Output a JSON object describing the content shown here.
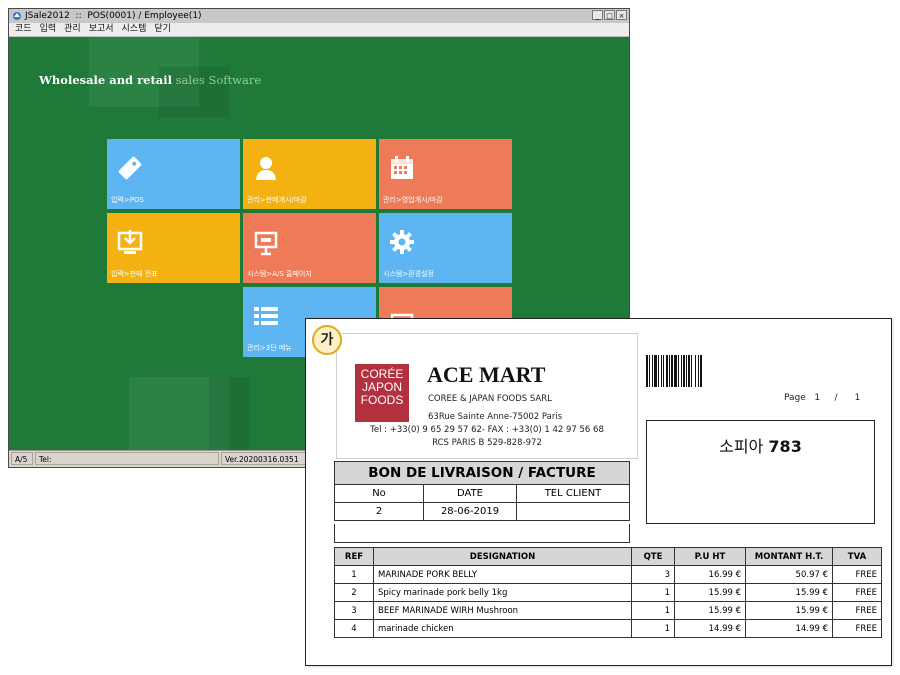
{
  "window": {
    "title": "JSale2012  ::  POS(0001) / Employee(1)",
    "min_label": "_",
    "max_label": "□",
    "close_label": "×"
  },
  "menu": [
    "코드",
    "입력",
    "관리",
    "보고서",
    "시스템",
    "닫기"
  ],
  "welcome": {
    "bold": "Wholesale and retail",
    "light": " sales Software"
  },
  "tiles": [
    {
      "label": "입력>POS",
      "icon": "price-tag-icon",
      "color": "#5db5f2"
    },
    {
      "label": "관리>판매개시/마감",
      "icon": "person-icon",
      "color": "#f3b212"
    },
    {
      "label": "관리>영업개시/마감",
      "icon": "calendar-icon",
      "color": "#ee7a57"
    },
    {
      "label": "입력>판매 전표",
      "icon": "download-tray-icon",
      "color": "#f3b212"
    },
    {
      "label": "시스템>A/S 홈페이지",
      "icon": "presentation-icon",
      "color": "#ee7a57"
    },
    {
      "label": "시스템>환경설정",
      "icon": "gear-icon",
      "color": "#5db5f2"
    },
    {
      "label": "관리>3단 메뉴",
      "icon": "list-icon",
      "color": "#5db5f2"
    }
  ],
  "status": {
    "left": "A/5",
    "tel": "Tel:",
    "version": "Ver.20200316.0351"
  },
  "doc": {
    "badge": "가",
    "logo_lines": [
      "CORÉE",
      "JAPON",
      "FOODS"
    ],
    "company_name": "ACE MART",
    "company_sub": "COREE & JAPAN FOODS SARL",
    "address": "63Rue Sainte Anne-75002 Paris",
    "tel_fax": "Tel : +33(0) 9 65 29 57 62- FAX : +33(0) 1 42 97 56 68",
    "rcs": "RCS PARIS B 529-828-972",
    "page_label": "Page",
    "page_current": "1",
    "page_sep": "/",
    "page_total": "1",
    "customer_name": "소피아",
    "customer_number": "783",
    "bl_title": "BON DE LIVRAISON / FACTURE",
    "bl_headers": [
      "No",
      "DATE",
      "TEL CLIENT"
    ],
    "bl_values": [
      "2",
      "28-06-2019",
      ""
    ],
    "item_headers": [
      "REF",
      "DESIGNATION",
      "QTE",
      "P.U HT",
      "MONTANT H.T.",
      "TVA"
    ],
    "items": [
      [
        "1",
        "MARINADE PORK BELLY",
        "3",
        "16.99 €",
        "50.97 €",
        "FREE"
      ],
      [
        "2",
        "Spicy marinade pork belly 1kg",
        "1",
        "15.99 €",
        "15.99 €",
        "FREE"
      ],
      [
        "3",
        "BEEF MARINADE WIRH Mushroon",
        "1",
        "15.99 €",
        "15.99 €",
        "FREE"
      ],
      [
        "4",
        "marinade chicken",
        "1",
        "14.99 €",
        "14.99 €",
        "FREE"
      ]
    ]
  }
}
